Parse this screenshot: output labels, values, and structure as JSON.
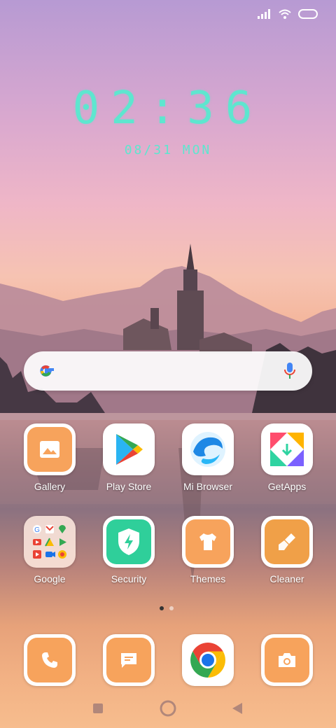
{
  "status": {
    "icons": [
      "signal-icon",
      "wifi-icon",
      "battery-icon"
    ]
  },
  "clock": {
    "time": "02:36",
    "date": "08/31 MON"
  },
  "search": {
    "logo": "google-logo-icon",
    "mic": "mic-icon"
  },
  "apps": [
    {
      "label": "Gallery",
      "icon": "gallery-icon"
    },
    {
      "label": "Play Store",
      "icon": "play-store-icon"
    },
    {
      "label": "Mi Browser",
      "icon": "mi-browser-icon"
    },
    {
      "label": "GetApps",
      "icon": "getapps-icon"
    },
    {
      "label": "Google",
      "icon": "google-folder-icon"
    },
    {
      "label": "Security",
      "icon": "security-shield-icon"
    },
    {
      "label": "Themes",
      "icon": "themes-shirt-icon"
    },
    {
      "label": "Cleaner",
      "icon": "cleaner-brush-icon"
    }
  ],
  "pages": {
    "count": 2,
    "active": 0
  },
  "dock": [
    {
      "icon": "phone-icon"
    },
    {
      "icon": "messages-icon"
    },
    {
      "icon": "chrome-icon"
    },
    {
      "icon": "camera-icon"
    }
  ],
  "nav": [
    "recents-square-icon",
    "home-circle-icon",
    "back-triangle-icon"
  ],
  "colors": {
    "clock": "#5ee6cf",
    "app_accent": "#f7a35c",
    "security": "#2fcf9a"
  }
}
